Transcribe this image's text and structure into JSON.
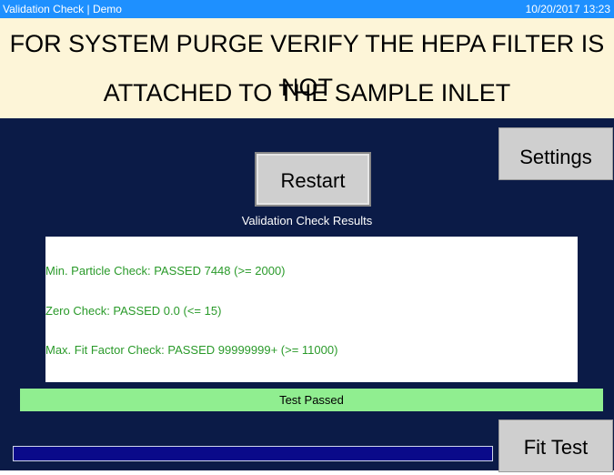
{
  "window": {
    "title": "Validation Check | Demo",
    "datetime": "10/20/2017 13:23"
  },
  "banner": {
    "line1": "FOR SYSTEM PURGE VERIFY THE HEPA FILTER IS NOT",
    "line2": "ATTACHED TO THE SAMPLE INLET"
  },
  "buttons": {
    "settings": "Settings",
    "restart": "Restart",
    "fit_test": "Fit Test"
  },
  "results": {
    "title": "Validation Check Results",
    "lines": [
      "Min. Particle Check: PASSED 7448 (>= 2000)",
      "Zero Check: PASSED 0.0 (<= 15)",
      "Max. Fit Factor Check: PASSED 99999999+ (>= 11000)"
    ]
  },
  "status": {
    "text": "Test Passed",
    "color": "#90ee90"
  },
  "progress": {
    "fraction": 0
  }
}
